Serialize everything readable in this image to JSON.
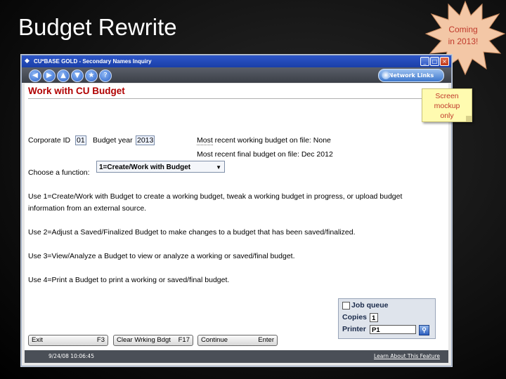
{
  "slide": {
    "title": "Budget Rewrite"
  },
  "badge": {
    "line1": "Coming",
    "line2": "in 2013!"
  },
  "sticky_note": {
    "line1": "Screen",
    "line2": "mockup",
    "line3": "only"
  },
  "window": {
    "title": "CU*BASE GOLD - Secondary Names Inquiry"
  },
  "toolbar": {
    "nav_icons": [
      "back-icon",
      "forward-icon",
      "up-icon",
      "down-icon",
      "favorite-icon",
      "help-icon"
    ],
    "network_links_label": "Network Links"
  },
  "screen": {
    "heading": "Work with CU Budget",
    "corporate_id_label": "Corporate ID",
    "corporate_id_value": "01",
    "budget_year_label": "Budget year",
    "budget_year_value": "2013",
    "recent_working_pre": "Most",
    "recent_working_label": " recent working budget on file:  None",
    "recent_final_label": "Most recent final budget on file:  Dec 2012",
    "choose_function_label": "Choose a function:",
    "function_selected": "1=Create/Work with Budget",
    "help_line_1a": "Use 1=Create/Work with Budget to create a working budget, tweak a working budget in progress, or upload budget",
    "help_line_1b": "information from an external source.",
    "help_line_2": "Use 2=Adjust a Saved/Finalized Budget to make changes to a budget that has been saved/finalized.",
    "help_line_3": "Use 3=View/Analyze a  Budget to view or analyze a working or saved/final budget.",
    "help_line_4": "Use 4=Print a Budget to print a working or saved/final budget."
  },
  "print_options": {
    "job_queue_label": "Job queue",
    "job_queue_checked": false,
    "copies_label": "Copies",
    "copies_value": "1",
    "printer_label": "Printer",
    "printer_value": "P1"
  },
  "fkeys": [
    {
      "label": "Exit",
      "key": "F3"
    },
    {
      "label": "Clear Wrking Bdgt",
      "key": "F17"
    },
    {
      "label": "Continue",
      "key": "Enter"
    }
  ],
  "status": {
    "timestamp": "9/24/08 10:06:45",
    "learn_link": "Learn About This Feature"
  }
}
